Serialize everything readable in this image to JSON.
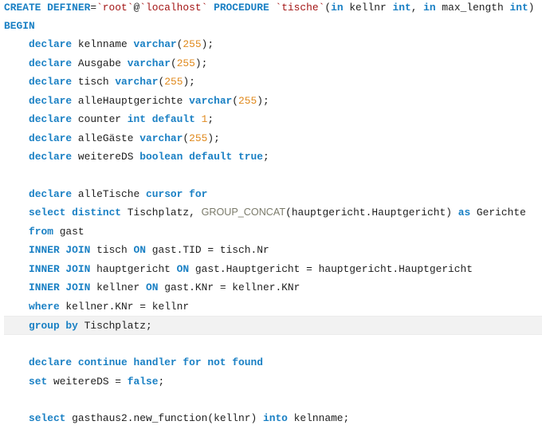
{
  "editor": {
    "language": "sql",
    "current_line_index": 17,
    "colors": {
      "keyword": "#1a80c4",
      "identifier": "#1e1e1e",
      "string": "#a31515",
      "number": "#e08a1e",
      "function": "#7a7a6a",
      "current_line_bg": "#f2f2f2"
    },
    "lines": [
      {
        "indent": 0,
        "tokens": [
          {
            "t": "kw",
            "v": "CREATE DEFINER"
          },
          {
            "t": "punct",
            "v": "="
          },
          {
            "t": "str",
            "v": "`root`"
          },
          {
            "t": "punct",
            "v": "@"
          },
          {
            "t": "str",
            "v": "`localhost`"
          },
          {
            "t": "punct",
            "v": " "
          },
          {
            "t": "kw",
            "v": "PROCEDURE"
          },
          {
            "t": "punct",
            "v": " "
          },
          {
            "t": "str",
            "v": "`tische`"
          },
          {
            "t": "punct",
            "v": "("
          },
          {
            "t": "kw",
            "v": "in"
          },
          {
            "t": "id",
            "v": " kellnr "
          },
          {
            "t": "kw",
            "v": "int"
          },
          {
            "t": "punct",
            "v": ", "
          },
          {
            "t": "kw",
            "v": "in"
          },
          {
            "t": "id",
            "v": " max_length "
          },
          {
            "t": "kw",
            "v": "int"
          },
          {
            "t": "punct",
            "v": ")"
          }
        ]
      },
      {
        "indent": 0,
        "tokens": [
          {
            "t": "kw",
            "v": "BEGIN"
          }
        ]
      },
      {
        "indent": 1,
        "tokens": [
          {
            "t": "kw",
            "v": "declare"
          },
          {
            "t": "id",
            "v": " kelnname "
          },
          {
            "t": "kw",
            "v": "varchar"
          },
          {
            "t": "punct",
            "v": "("
          },
          {
            "t": "num",
            "v": "255"
          },
          {
            "t": "punct",
            "v": ");"
          }
        ]
      },
      {
        "indent": 1,
        "tokens": [
          {
            "t": "kw",
            "v": "declare"
          },
          {
            "t": "id",
            "v": " Ausgabe "
          },
          {
            "t": "kw",
            "v": "varchar"
          },
          {
            "t": "punct",
            "v": "("
          },
          {
            "t": "num",
            "v": "255"
          },
          {
            "t": "punct",
            "v": ");"
          }
        ]
      },
      {
        "indent": 1,
        "tokens": [
          {
            "t": "kw",
            "v": "declare"
          },
          {
            "t": "id",
            "v": " tisch "
          },
          {
            "t": "kw",
            "v": "varchar"
          },
          {
            "t": "punct",
            "v": "("
          },
          {
            "t": "num",
            "v": "255"
          },
          {
            "t": "punct",
            "v": ");"
          }
        ]
      },
      {
        "indent": 1,
        "tokens": [
          {
            "t": "kw",
            "v": "declare"
          },
          {
            "t": "id",
            "v": " alleHauptgerichte "
          },
          {
            "t": "kw",
            "v": "varchar"
          },
          {
            "t": "punct",
            "v": "("
          },
          {
            "t": "num",
            "v": "255"
          },
          {
            "t": "punct",
            "v": ");"
          }
        ]
      },
      {
        "indent": 1,
        "tokens": [
          {
            "t": "kw",
            "v": "declare"
          },
          {
            "t": "id",
            "v": " counter "
          },
          {
            "t": "kw",
            "v": "int default"
          },
          {
            "t": "punct",
            "v": " "
          },
          {
            "t": "num",
            "v": "1"
          },
          {
            "t": "punct",
            "v": ";"
          }
        ]
      },
      {
        "indent": 1,
        "tokens": [
          {
            "t": "kw",
            "v": "declare"
          },
          {
            "t": "id",
            "v": " alleGäste "
          },
          {
            "t": "kw",
            "v": "varchar"
          },
          {
            "t": "punct",
            "v": "("
          },
          {
            "t": "num",
            "v": "255"
          },
          {
            "t": "punct",
            "v": ");"
          }
        ]
      },
      {
        "indent": 1,
        "tokens": [
          {
            "t": "kw",
            "v": "declare"
          },
          {
            "t": "id",
            "v": " weitereDS "
          },
          {
            "t": "kw",
            "v": "boolean default true"
          },
          {
            "t": "punct",
            "v": ";"
          }
        ]
      },
      {
        "indent": 0,
        "tokens": []
      },
      {
        "indent": 1,
        "tokens": [
          {
            "t": "kw",
            "v": "declare"
          },
          {
            "t": "id",
            "v": " alleTische "
          },
          {
            "t": "kw",
            "v": "cursor for"
          }
        ]
      },
      {
        "indent": 1,
        "tokens": [
          {
            "t": "kw",
            "v": "select distinct"
          },
          {
            "t": "id",
            "v": " Tischplatz, "
          },
          {
            "t": "fn",
            "v": "GROUP_CONCAT"
          },
          {
            "t": "punct",
            "v": "("
          },
          {
            "t": "id",
            "v": "hauptgericht.Hauptgericht"
          },
          {
            "t": "punct",
            "v": ") "
          },
          {
            "t": "kw",
            "v": "as"
          },
          {
            "t": "id",
            "v": " Gerichte"
          }
        ]
      },
      {
        "indent": 1,
        "tokens": [
          {
            "t": "kw",
            "v": "from"
          },
          {
            "t": "id",
            "v": " gast"
          }
        ]
      },
      {
        "indent": 1,
        "tokens": [
          {
            "t": "kw",
            "v": "INNER JOIN"
          },
          {
            "t": "id",
            "v": " tisch "
          },
          {
            "t": "kw",
            "v": "ON"
          },
          {
            "t": "id",
            "v": " gast.TID = tisch.Nr"
          }
        ]
      },
      {
        "indent": 1,
        "tokens": [
          {
            "t": "kw",
            "v": "INNER JOIN"
          },
          {
            "t": "id",
            "v": " hauptgericht "
          },
          {
            "t": "kw",
            "v": "ON"
          },
          {
            "t": "id",
            "v": " gast.Hauptgericht = hauptgericht.Hauptgericht"
          }
        ]
      },
      {
        "indent": 1,
        "tokens": [
          {
            "t": "kw",
            "v": "INNER JOIN"
          },
          {
            "t": "id",
            "v": " kellner "
          },
          {
            "t": "kw",
            "v": "ON"
          },
          {
            "t": "id",
            "v": " gast.KNr = kellner.KNr"
          }
        ]
      },
      {
        "indent": 1,
        "tokens": [
          {
            "t": "kw",
            "v": "where"
          },
          {
            "t": "id",
            "v": " kellner.KNr = kellnr"
          }
        ]
      },
      {
        "indent": 1,
        "tokens": [
          {
            "t": "kw",
            "v": "group by"
          },
          {
            "t": "id",
            "v": " Tischplatz;"
          }
        ]
      },
      {
        "indent": 0,
        "tokens": []
      },
      {
        "indent": 1,
        "tokens": [
          {
            "t": "kw",
            "v": "declare continue handler for not found"
          }
        ]
      },
      {
        "indent": 1,
        "tokens": [
          {
            "t": "kw",
            "v": "set"
          },
          {
            "t": "id",
            "v": " weitereDS = "
          },
          {
            "t": "kw",
            "v": "false"
          },
          {
            "t": "punct",
            "v": ";"
          }
        ]
      },
      {
        "indent": 0,
        "tokens": []
      },
      {
        "indent": 1,
        "tokens": [
          {
            "t": "kw",
            "v": "select"
          },
          {
            "t": "id",
            "v": " gasthaus2.new_function(kellnr) "
          },
          {
            "t": "kw",
            "v": "into"
          },
          {
            "t": "id",
            "v": " kelnname;"
          }
        ]
      }
    ]
  }
}
